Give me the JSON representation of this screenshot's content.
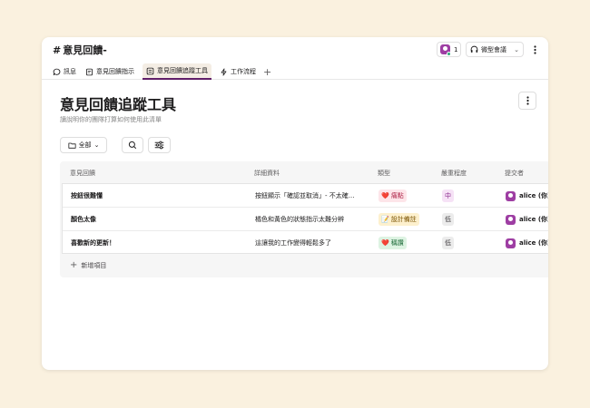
{
  "channel": {
    "name": "意見回饋-",
    "hash": "#"
  },
  "header": {
    "member_count": "1",
    "huddle_label": "微型會議"
  },
  "tabs": [
    {
      "label": "訊息",
      "icon": "message-icon"
    },
    {
      "label": "意見回饋指示",
      "icon": "canvas-icon"
    },
    {
      "label": "意見回饋追蹤工具",
      "icon": "list-icon",
      "active": true
    },
    {
      "label": "工作流程",
      "icon": "workflow-icon"
    }
  ],
  "list": {
    "title": "意見回饋追蹤工具",
    "description": "讀說明你的團隊打算如何使用此清單",
    "filter_label": "全部"
  },
  "table": {
    "columns": [
      "意見回饋",
      "詳細資料",
      "類型",
      "嚴重程度",
      "提交者"
    ],
    "rows": [
      {
        "title": "按鈕很難懂",
        "detail": "按鈕顯示「確認並取消」- 不太確...",
        "type": "痛點",
        "type_emoji": "❤️",
        "severity": "中",
        "submitter": "alice (你)"
      },
      {
        "title": "顏色太像",
        "detail": "橘色和黃色的狀態指示太難分辨",
        "type": "設計備註",
        "type_emoji": "📝",
        "severity": "低",
        "submitter": "alice (你)"
      },
      {
        "title": "喜歡新的更新！",
        "detail": "這讓我的工作變得輕鬆多了",
        "type": "稱讚",
        "type_emoji": "❤️",
        "severity": "低",
        "submitter": "alice (你)"
      }
    ],
    "add_label": "新增項目"
  },
  "colors": {
    "accent": "#611f69",
    "avatar": "#9e3ea3",
    "background": "#faf1df"
  }
}
